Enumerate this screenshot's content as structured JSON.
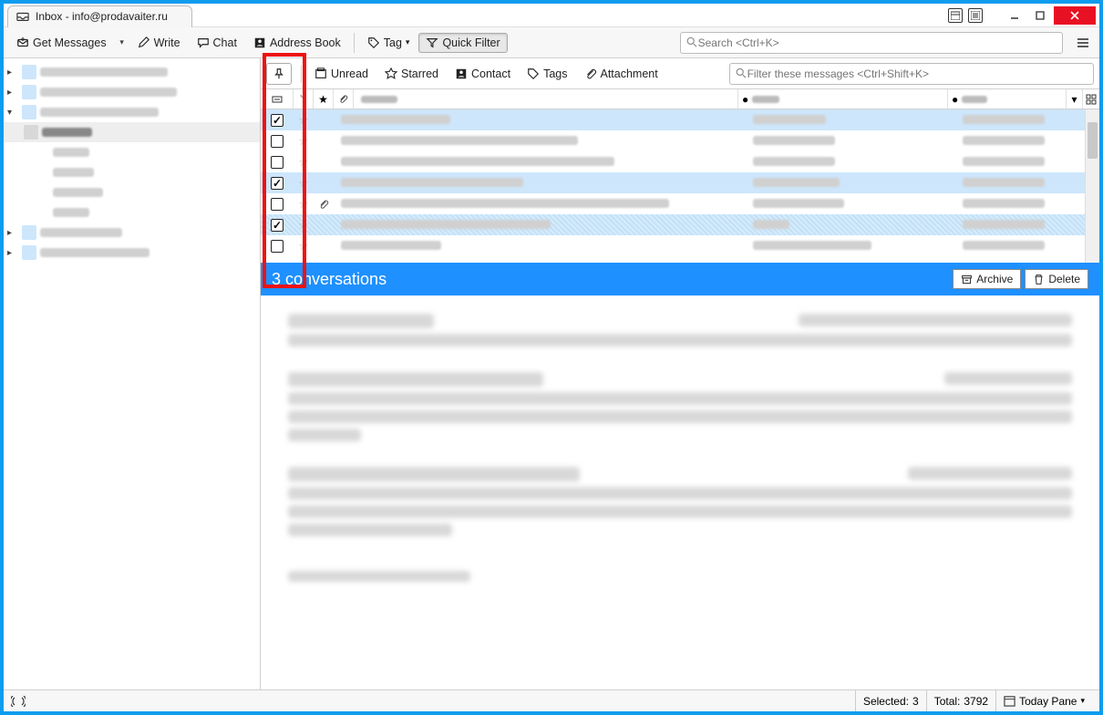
{
  "window": {
    "title": "Inbox - info@prodavaiter.ru"
  },
  "toolbar": {
    "get_messages": "Get Messages",
    "write": "Write",
    "chat": "Chat",
    "address_book": "Address Book",
    "tag": "Tag",
    "quick_filter": "Quick Filter",
    "search_placeholder": "Search <Ctrl+K>"
  },
  "filterbar": {
    "unread": "Unread",
    "starred": "Starred",
    "contact": "Contact",
    "tags": "Tags",
    "attachment": "Attachment",
    "filter_placeholder": "Filter these messages <Ctrl+Shift+K>"
  },
  "columns": {
    "subject": "Subject",
    "from": "From",
    "date": "Date"
  },
  "messages": [
    {
      "checked": true,
      "star": "empty",
      "att": false,
      "selected": true,
      "dotted": false,
      "subj_w": 120,
      "from_w": 80,
      "date_w": 90
    },
    {
      "checked": false,
      "star": "empty",
      "att": false,
      "selected": false,
      "dotted": false,
      "subj_w": 260,
      "from_w": 90,
      "date_w": 90
    },
    {
      "checked": false,
      "star": "empty",
      "att": false,
      "selected": false,
      "dotted": false,
      "subj_w": 300,
      "from_w": 90,
      "date_w": 90
    },
    {
      "checked": true,
      "star": "empty",
      "att": false,
      "selected": true,
      "dotted": false,
      "subj_w": 200,
      "from_w": 95,
      "date_w": 90
    },
    {
      "checked": false,
      "star": "empty",
      "att": true,
      "selected": false,
      "dotted": false,
      "subj_w": 360,
      "from_w": 100,
      "date_w": 90
    },
    {
      "checked": true,
      "star": "empty",
      "att": false,
      "selected": true,
      "dotted": true,
      "subj_w": 230,
      "from_w": 40,
      "date_w": 90
    },
    {
      "checked": false,
      "star": "empty",
      "att": false,
      "selected": false,
      "dotted": false,
      "subj_w": 110,
      "from_w": 130,
      "date_w": 90
    }
  ],
  "conversation": {
    "title": "3 conversations",
    "archive": "Archive",
    "delete": "Delete"
  },
  "statusbar": {
    "selected_label": "Selected:",
    "selected_count": "3",
    "total_label": "Total:",
    "total_count": "3792",
    "today_pane": "Today Pane"
  }
}
